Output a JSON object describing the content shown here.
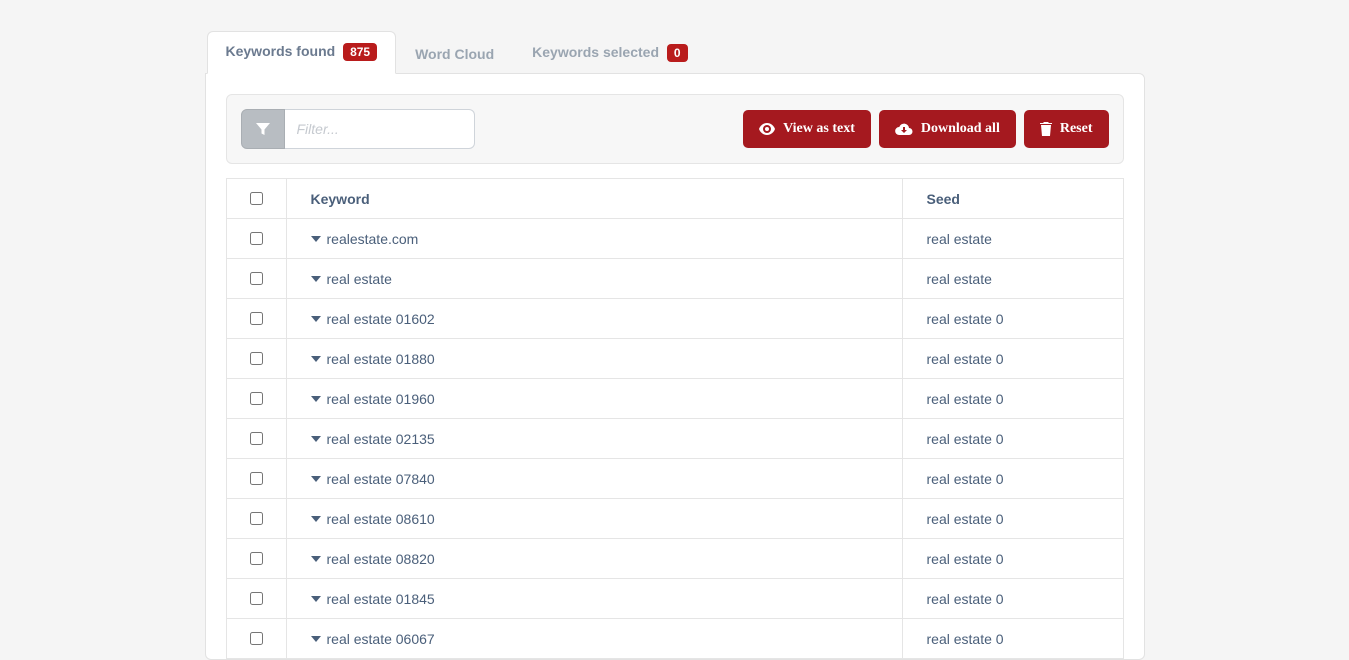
{
  "tabs": {
    "keywords_found": {
      "label": "Keywords found",
      "count": "875"
    },
    "word_cloud": {
      "label": "Word Cloud"
    },
    "keywords_selected": {
      "label": "Keywords selected",
      "count": "0"
    }
  },
  "toolbar": {
    "filter_placeholder": "Filter...",
    "view_as_text": "View as text",
    "download_all": "Download all",
    "reset": "Reset"
  },
  "table": {
    "header_keyword": "Keyword",
    "header_seed": "Seed",
    "rows": [
      {
        "keyword": "realestate.com",
        "seed": "real estate"
      },
      {
        "keyword": "real estate",
        "seed": "real estate"
      },
      {
        "keyword": "real estate 01602",
        "seed": "real estate 0"
      },
      {
        "keyword": "real estate 01880",
        "seed": "real estate 0"
      },
      {
        "keyword": "real estate 01960",
        "seed": "real estate 0"
      },
      {
        "keyword": "real estate 02135",
        "seed": "real estate 0"
      },
      {
        "keyword": "real estate 07840",
        "seed": "real estate 0"
      },
      {
        "keyword": "real estate 08610",
        "seed": "real estate 0"
      },
      {
        "keyword": "real estate 08820",
        "seed": "real estate 0"
      },
      {
        "keyword": "real estate 01845",
        "seed": "real estate 0"
      },
      {
        "keyword": "real estate 06067",
        "seed": "real estate 0"
      }
    ]
  }
}
